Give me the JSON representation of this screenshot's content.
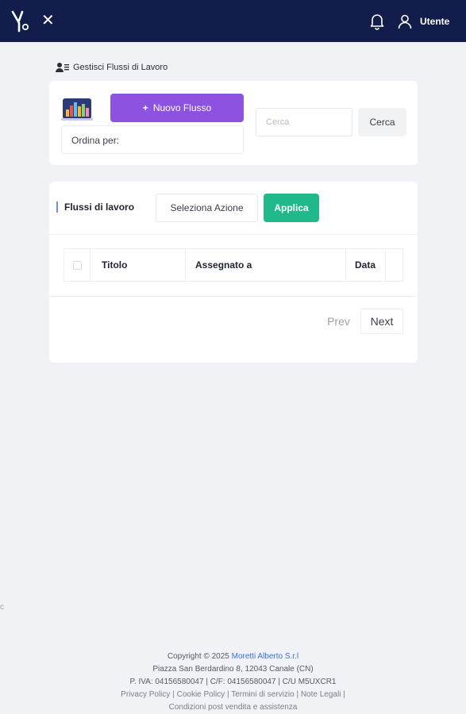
{
  "header": {
    "user_label": "Utente",
    "close_symbol": "✕",
    "bg_color": "#131d4b"
  },
  "page": {
    "title": "Gestisci Flussi di Lavoro"
  },
  "toolbar": {
    "new_flow_label": "Nuovo Flusso",
    "new_flow_plus": "+",
    "sort_label": "Ordina per:",
    "search_placeholder": "Cerca",
    "search_button": "Cerca",
    "accent_color": "#8d53e0"
  },
  "flows": {
    "section_title": "Flussi di lavoro",
    "select_action": "Seleziona Azione",
    "apply_label": "Applica",
    "apply_color": "#21b98a",
    "columns": [
      "Titolo",
      "Assegnato a",
      "Data"
    ],
    "prev_label": "Prev",
    "next_label": "Next"
  },
  "footer": {
    "copyright": "Copyright © 2025",
    "company": "Moretti Alberto S.r.l",
    "address": "Piazza San Berdardino 8, 12043 Canale (CN)",
    "tax": "P. IVA: 04156580047 | C/F: 04156580047 | C/U M5UXCR1",
    "links": [
      "Privacy Policy",
      "Cookie Policy",
      "Termini di servizio",
      "Note Legali"
    ],
    "conditions": "Condizioni post vendita e assistenza",
    "separator": "|"
  },
  "icons": {
    "logo": "logo-icon",
    "close": "close-icon",
    "bell": "bell-icon",
    "user": "user-icon",
    "users": "users-icon",
    "chart": "chart-icon"
  },
  "edge_mark": "c"
}
